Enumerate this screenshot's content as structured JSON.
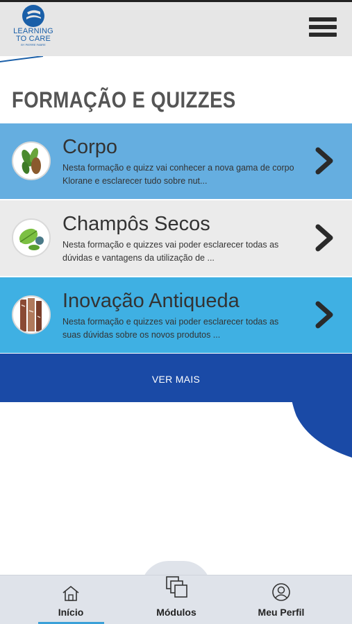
{
  "header": {
    "logo_line1": "LEARNING",
    "logo_line2": "TO CARE",
    "logo_sub": "BY PIERRE FABRE",
    "menu_icon": "hamburger-menu-icon"
  },
  "section": {
    "title": "FORMAÇÃO E QUIZZES"
  },
  "courses": [
    {
      "title": "Corpo",
      "description": "Nesta formação e quizz vai conhecer a nova gama de corpo Klorane e esclarecer tudo sobre nut...",
      "icon": "leaves-icon",
      "bg": "#65aee0"
    },
    {
      "title": "Champôs Secos",
      "description": "Nesta formação e quizzes vai poder esclarecer todas as dúvidas e vantagens da utilização de ...",
      "icon": "nettle-leaf-icon",
      "bg": "#ebebeb"
    },
    {
      "title": "Inovação Antiqueda",
      "description": "Nesta formação e quizzes vai poder esclarecer todas as suas dúvidas sobre os novos produtos ...",
      "icon": "bark-icon",
      "bg": "#3fb0e3"
    }
  ],
  "ver_mais": {
    "label": "VER MAIS",
    "bg": "#1a4aa6"
  },
  "bottom_nav": {
    "items": [
      {
        "label": "Início",
        "icon": "home-icon",
        "active": true
      },
      {
        "label": "Módulos",
        "icon": "modules-icon",
        "active": false
      },
      {
        "label": "Meu Perfil",
        "icon": "profile-icon",
        "active": false
      }
    ],
    "active_color": "#3aa0d8"
  },
  "colors": {
    "brand": "#1a5fa8",
    "dark_blue": "#1a4aa6"
  }
}
